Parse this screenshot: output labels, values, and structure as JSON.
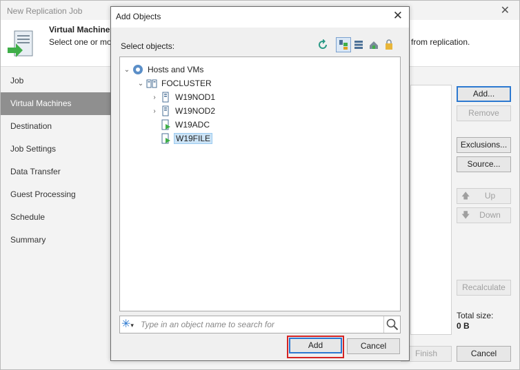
{
  "wizard": {
    "title": "New Replication Job",
    "header_title": "Virtual Machines",
    "header_desc": "Select one or mo",
    "header_desc_tail": "from replication.",
    "nav": [
      {
        "label": "Job",
        "active": false
      },
      {
        "label": "Virtual Machines",
        "active": true
      },
      {
        "label": "Destination",
        "active": false
      },
      {
        "label": "Job Settings",
        "active": false
      },
      {
        "label": "Data Transfer",
        "active": false
      },
      {
        "label": "Guest Processing",
        "active": false
      },
      {
        "label": "Schedule",
        "active": false
      },
      {
        "label": "Summary",
        "active": false
      }
    ],
    "buttons": {
      "add": "Add...",
      "remove": "Remove",
      "exclusions": "Exclusions...",
      "source": "Source...",
      "up": "Up",
      "down": "Down",
      "recalculate": "Recalculate",
      "finish": "Finish",
      "cancel": "Cancel"
    },
    "total_size_label": "Total size:",
    "total_size_value": "0 B"
  },
  "dialog": {
    "title": "Add Objects",
    "select_label": "Select objects:",
    "tree": [
      {
        "label": "Hosts and VMs",
        "level": 0,
        "expander": "open",
        "icon": "hosts-icon",
        "selected": false
      },
      {
        "label": "FOCLUSTER",
        "level": 1,
        "expander": "open",
        "icon": "cluster-icon",
        "selected": false
      },
      {
        "label": "W19NOD1",
        "level": 2,
        "expander": "closed",
        "icon": "server-icon",
        "selected": false
      },
      {
        "label": "W19NOD2",
        "level": 2,
        "expander": "closed",
        "icon": "server-icon",
        "selected": false
      },
      {
        "label": "W19ADC",
        "level": 2,
        "expander": "none",
        "icon": "vm-icon",
        "selected": false
      },
      {
        "label": "W19FILE",
        "level": 2,
        "expander": "none",
        "icon": "vm-icon",
        "selected": true
      }
    ],
    "search_placeholder": "Type in an object name to search for",
    "add_label": "Add",
    "cancel_label": "Cancel"
  },
  "colors": {
    "accent": "#2b78d0",
    "highlight": "#d42323",
    "veeam_green": "#3fae49"
  }
}
